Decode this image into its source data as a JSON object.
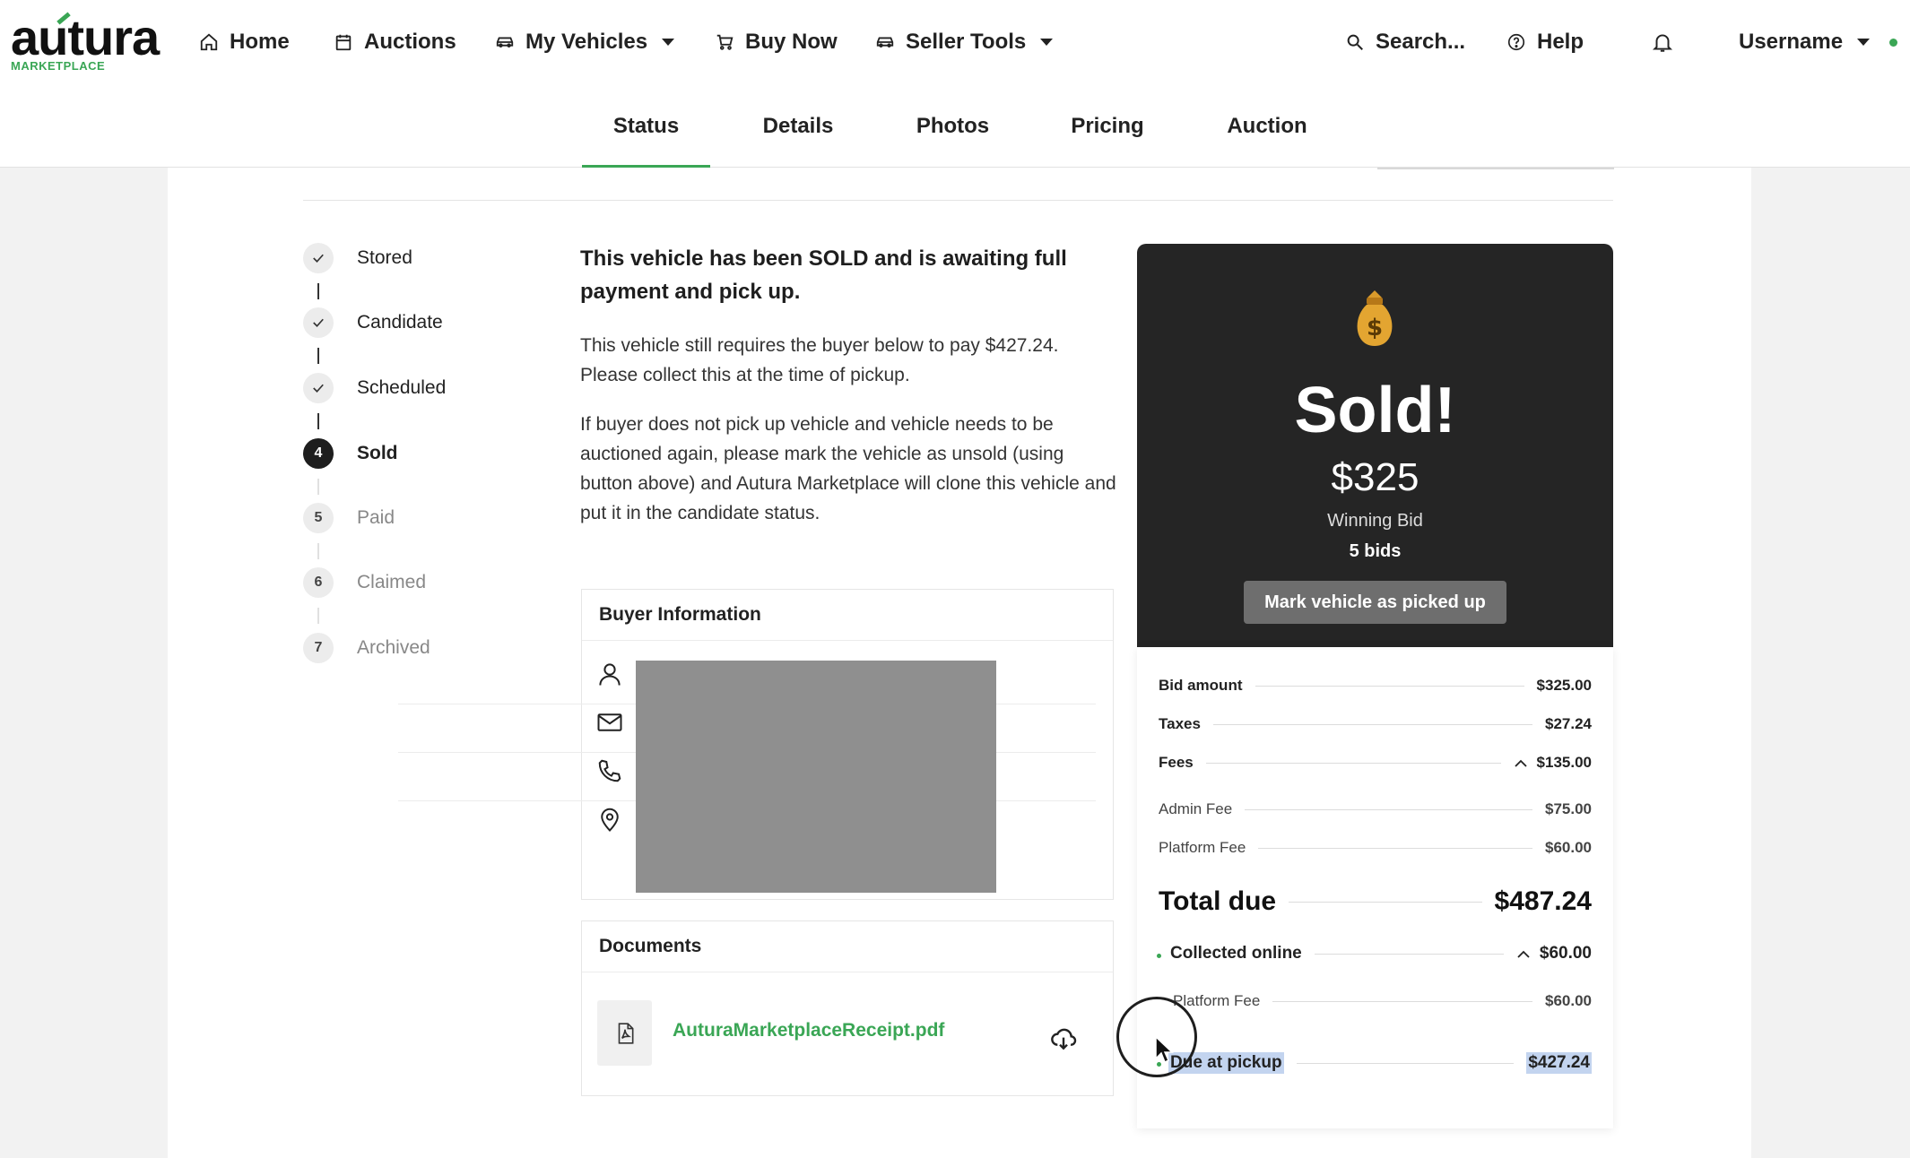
{
  "brand": {
    "name": "autura",
    "sub": "MARKETPLACE"
  },
  "nav": {
    "home": "Home",
    "auctions": "Auctions",
    "my_vehicles": "My Vehicles",
    "buy_now": "Buy Now",
    "seller_tools": "Seller Tools",
    "search": "Search...",
    "help": "Help",
    "username": "Username"
  },
  "tabs": [
    "Status",
    "Details",
    "Photos",
    "Pricing",
    "Auction"
  ],
  "active_tab": "Status",
  "steps": [
    {
      "num": "✓",
      "label": "Stored",
      "state": "done"
    },
    {
      "num": "✓",
      "label": "Candidate",
      "state": "done"
    },
    {
      "num": "✓",
      "label": "Scheduled",
      "state": "done"
    },
    {
      "num": "4",
      "label": "Sold",
      "state": "current"
    },
    {
      "num": "5",
      "label": "Paid",
      "state": "todo"
    },
    {
      "num": "6",
      "label": "Claimed",
      "state": "todo"
    },
    {
      "num": "7",
      "label": "Archived",
      "state": "todo"
    }
  ],
  "status": {
    "headline": "This vehicle has been SOLD and is awaiting full payment and pick up.",
    "para1": "This vehicle still requires the buyer below to pay $427.24. Please collect this at the time of pickup.",
    "para2": "If buyer does not pick up vehicle and vehicle needs to be auctioned again, please mark the vehicle as unsold (using button above) and Autura Marketplace will clone this vehicle and put it in the candidate status."
  },
  "buyer": {
    "title": "Buyer Information"
  },
  "documents": {
    "title": "Documents",
    "file": "AuturaMarketplaceReceipt.pdf"
  },
  "sold_card": {
    "title": "Sold!",
    "amount": "$325",
    "amount_label": "Winning Bid",
    "bids": "5 bids",
    "button": "Mark vehicle as picked up"
  },
  "breakdown": {
    "bid_amount": {
      "label": "Bid amount",
      "value": "$325.00"
    },
    "taxes": {
      "label": "Taxes",
      "value": "$27.24"
    },
    "fees": {
      "label": "Fees",
      "value": "$135.00"
    },
    "admin_fee": {
      "label": "Admin Fee",
      "value": "$75.00"
    },
    "platform_fee": {
      "label": "Platform Fee",
      "value": "$60.00"
    },
    "total_due": {
      "label": "Total due",
      "value": "$487.24"
    },
    "collected_online": {
      "label": "Collected online",
      "value": "$60.00"
    },
    "collected_platform_fee": {
      "label": "Platform Fee",
      "value": "$60.00"
    },
    "due_at_pickup": {
      "label": "Due at pickup",
      "value": "$427.24"
    }
  },
  "colors": {
    "accent": "#3aa655",
    "dark_card": "#252525",
    "button_gray": "#6e6e6e"
  }
}
